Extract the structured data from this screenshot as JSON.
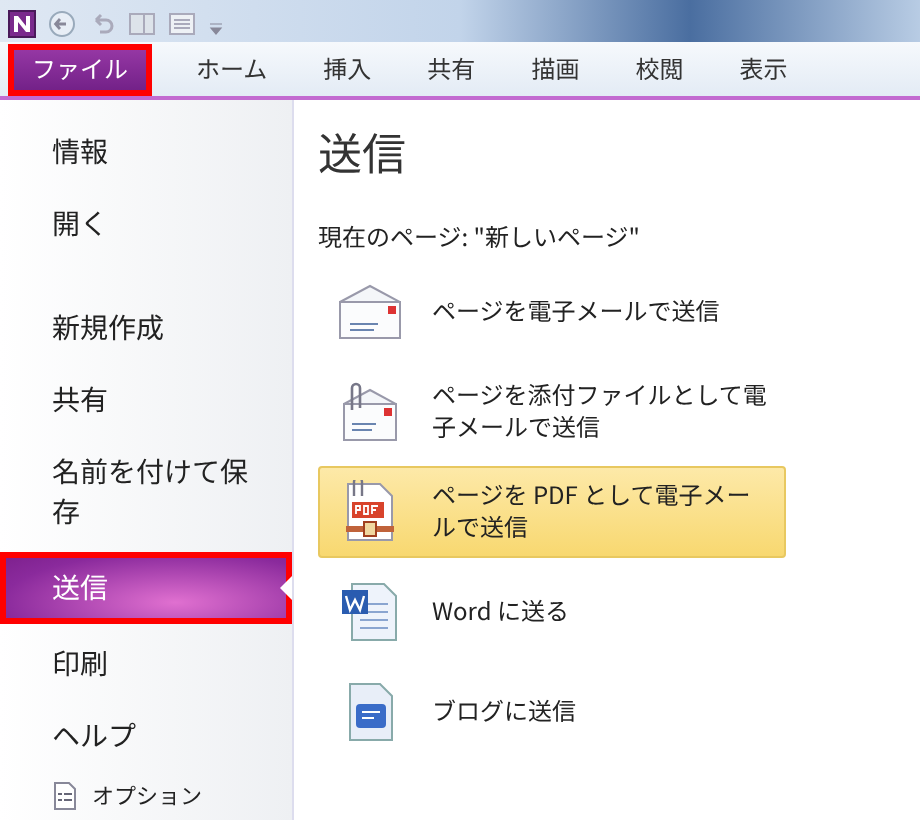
{
  "tabs": [
    {
      "label": "ファイル",
      "selected": true
    },
    {
      "label": "ホーム",
      "selected": false
    },
    {
      "label": "挿入",
      "selected": false
    },
    {
      "label": "共有",
      "selected": false
    },
    {
      "label": "描画",
      "selected": false
    },
    {
      "label": "校閲",
      "selected": false
    },
    {
      "label": "表示",
      "selected": false
    }
  ],
  "sidebar": {
    "sections": [
      [
        {
          "label": "情報",
          "kind": "command",
          "selected": false
        },
        {
          "label": "開く",
          "kind": "command",
          "selected": false
        }
      ],
      [
        {
          "label": "新規作成",
          "kind": "command",
          "selected": false
        },
        {
          "label": "共有",
          "kind": "command",
          "selected": false
        },
        {
          "label": "名前を付けて保存",
          "kind": "command",
          "selected": false
        },
        {
          "label": "送信",
          "kind": "command",
          "selected": true
        },
        {
          "label": "印刷",
          "kind": "command",
          "selected": false
        },
        {
          "label": "ヘルプ",
          "kind": "command",
          "selected": false
        },
        {
          "label": "オプション",
          "kind": "option",
          "selected": false
        }
      ]
    ]
  },
  "panel": {
    "title": "送信",
    "current_page": "現在のページ: \"新しいページ\"",
    "options": [
      {
        "label": "ページを電子メールで送信",
        "kind": "mail",
        "selected": false
      },
      {
        "label": "ページを添付ファイルとして電子メールで送信",
        "kind": "attach",
        "selected": false
      },
      {
        "label": "ページを PDF として電子メールで送信",
        "kind": "pdf",
        "selected": true
      },
      {
        "label": "Word に送る",
        "kind": "word",
        "selected": false
      },
      {
        "label": "ブログに送信",
        "kind": "blog",
        "selected": false
      }
    ]
  }
}
